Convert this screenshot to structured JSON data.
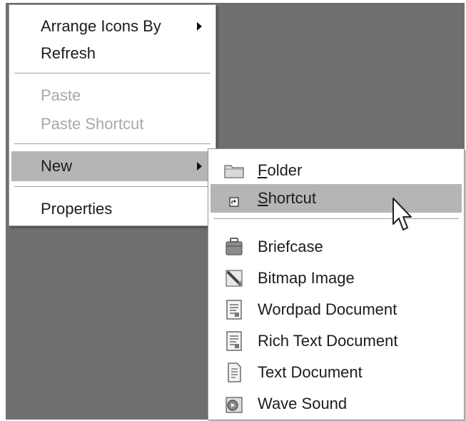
{
  "context_menu": {
    "items": [
      {
        "label": "Arrange Icons By",
        "has_submenu": true
      },
      {
        "label": "Refresh"
      },
      {
        "label": "Paste",
        "disabled": true
      },
      {
        "label": "Paste Shortcut",
        "disabled": true
      },
      {
        "label": "New",
        "has_submenu": true,
        "highlighted": true
      },
      {
        "label": "Properties"
      }
    ]
  },
  "new_submenu": {
    "items": [
      {
        "accel": "F",
        "rest": "older",
        "icon": "folder-icon"
      },
      {
        "accel": "S",
        "rest": "hortcut",
        "icon": "shortcut-icon",
        "highlighted": true
      },
      {
        "label": "Briefcase",
        "icon": "briefcase-icon"
      },
      {
        "label": "Bitmap Image",
        "icon": "bitmap-image-icon"
      },
      {
        "label": "Wordpad Document",
        "icon": "wordpad-document-icon"
      },
      {
        "label": "Rich Text Document",
        "icon": "rich-text-document-icon"
      },
      {
        "label": "Text Document",
        "icon": "text-document-icon"
      },
      {
        "label": "Wave Sound",
        "icon": "wave-sound-icon"
      }
    ]
  },
  "colors": {
    "desktop": "#6f6f6f",
    "highlight": "#b5b5b5",
    "disabled_text": "#a8a8a8"
  }
}
